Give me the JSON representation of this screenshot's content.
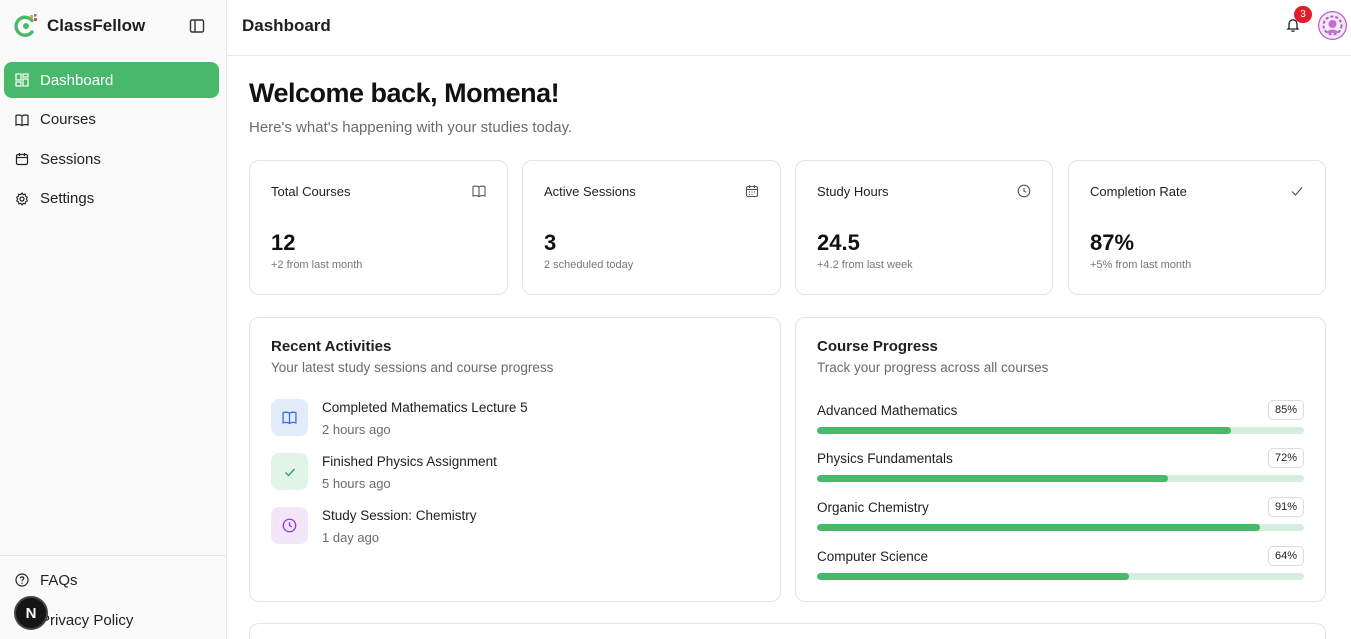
{
  "brand": {
    "name": "ClassFellow"
  },
  "sidebar": {
    "items": [
      {
        "label": "Dashboard",
        "icon": "dashboard-icon",
        "active": true
      },
      {
        "label": "Courses",
        "icon": "book-icon",
        "active": false
      },
      {
        "label": "Sessions",
        "icon": "calendar-icon",
        "active": false
      },
      {
        "label": "Settings",
        "icon": "gear-icon",
        "active": false
      }
    ],
    "bottom_items": [
      {
        "label": "FAQs",
        "icon": "help-circle-icon"
      },
      {
        "label": "Privacy Policy",
        "icon": "shield-icon"
      }
    ],
    "dev_badge": "N"
  },
  "header": {
    "title": "Dashboard",
    "notification_count": "3"
  },
  "welcome": {
    "title": "Welcome back, Momena!",
    "subtitle": "Here's what's happening with your studies today."
  },
  "stats": [
    {
      "title": "Total Courses",
      "value": "12",
      "note": "+2 from last month",
      "icon": "book-icon"
    },
    {
      "title": "Active Sessions",
      "value": "3",
      "note": "2 scheduled today",
      "icon": "calendar-icon"
    },
    {
      "title": "Study Hours",
      "value": "24.5",
      "note": "+4.2 from last week",
      "icon": "clock-icon"
    },
    {
      "title": "Completion Rate",
      "value": "87%",
      "note": "+5% from last month",
      "icon": "check-icon"
    }
  ],
  "recent": {
    "title": "Recent Activities",
    "subtitle": "Your latest study sessions and course progress",
    "items": [
      {
        "title": "Completed Mathematics Lecture 5",
        "time": "2 hours ago",
        "icon": "book-icon",
        "color": "#2f6fe0",
        "bg": "#e3ecfb"
      },
      {
        "title": "Finished Physics Assignment",
        "time": "5 hours ago",
        "icon": "check-icon",
        "color": "#2f9e57",
        "bg": "#e0f5e7"
      },
      {
        "title": "Study Session: Chemistry",
        "time": "1 day ago",
        "icon": "clock-icon",
        "color": "#9333ea",
        "bg": "#f2e6fb"
      }
    ]
  },
  "progress": {
    "title": "Course Progress",
    "subtitle": "Track your progress across all courses",
    "courses": [
      {
        "name": "Advanced Mathematics",
        "label": "85%",
        "value": 0.85
      },
      {
        "name": "Physics Fundamentals",
        "label": "72%",
        "value": 0.72
      },
      {
        "name": "Organic Chemistry",
        "label": "91%",
        "value": 0.91
      },
      {
        "name": "Computer Science",
        "label": "64%",
        "value": 0.64
      }
    ]
  },
  "colors": {
    "accent": "#48b86b",
    "track": "#d6eedd",
    "badge": "#e11d2a"
  }
}
